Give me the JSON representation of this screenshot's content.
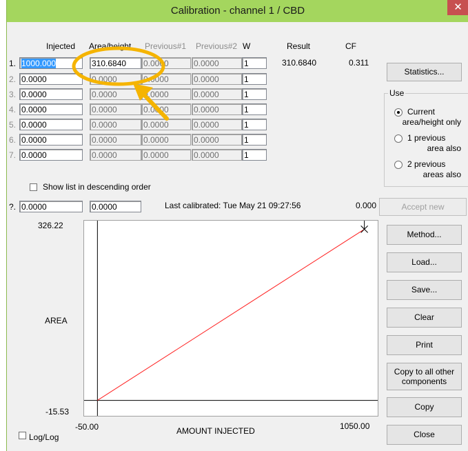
{
  "window": {
    "title": "Calibration - channel 1 / CBD",
    "close_glyph": "✕"
  },
  "table": {
    "headers": {
      "injected": "Injected",
      "area_height": "Area/height",
      "prev1": "Previous#1",
      "prev2": "Previous#2",
      "w": "W",
      "result": "Result",
      "cf": "CF"
    },
    "rows": [
      {
        "num": "1.",
        "injected": "1000.000",
        "area": "310.6840",
        "prev1": "0.0000",
        "prev2": "0.0000",
        "w": "1",
        "result": "310.6840",
        "cf": "0.311"
      },
      {
        "num": "2.",
        "injected": "0.0000",
        "area": "0.0000",
        "prev1": "0.0000",
        "prev2": "0.0000",
        "w": "1"
      },
      {
        "num": "3.",
        "injected": "0.0000",
        "area": "0.0000",
        "prev1": "0.0000",
        "prev2": "0.0000",
        "w": "1"
      },
      {
        "num": "4.",
        "injected": "0.0000",
        "area": "0.0000",
        "prev1": "0.0000",
        "prev2": "0.0000",
        "w": "1"
      },
      {
        "num": "5.",
        "injected": "0.0000",
        "area": "0.0000",
        "prev1": "0.0000",
        "prev2": "0.0000",
        "w": "1"
      },
      {
        "num": "6.",
        "injected": "0.0000",
        "area": "0.0000",
        "prev1": "0.0000",
        "prev2": "0.0000",
        "w": "1"
      },
      {
        "num": "7.",
        "injected": "0.0000",
        "area": "0.0000",
        "prev1": "0.0000",
        "prev2": "0.0000",
        "w": "1"
      }
    ],
    "descending_label": "Show list in descending order"
  },
  "query": {
    "num": "?.",
    "injected": "0.0000",
    "area": "0.0000",
    "last_calibrated": "Last calibrated:  Tue May 21 09:27:56",
    "value": "0.000"
  },
  "use_group": {
    "title": "Use",
    "options": [
      {
        "label1": "Current",
        "label2": "area/height only",
        "selected": true
      },
      {
        "label1": "1 previous",
        "label2": "area also",
        "selected": false
      },
      {
        "label1": "2 previous",
        "label2": "areas also",
        "selected": false
      }
    ]
  },
  "buttons": {
    "statistics": "Statistics...",
    "accept_new": "Accept new",
    "method": "Method...",
    "load": "Load...",
    "save": "Save...",
    "clear": "Clear",
    "print": "Print",
    "copy_all_1": "Copy to all other",
    "copy_all_2": "components",
    "copy": "Copy",
    "close": "Close"
  },
  "loglog_label": "Log/Log",
  "chart_data": {
    "type": "line",
    "xlabel": "AMOUNT INJECTED",
    "ylabel": "AREA",
    "xlim": [
      -50.0,
      1050.0
    ],
    "ylim": [
      -15.53,
      326.22
    ],
    "x_tick_labels": [
      "-50.00",
      "1050.00"
    ],
    "y_tick_labels": [
      "326.22",
      "-15.53"
    ],
    "series": [
      {
        "x": [
          0,
          1000
        ],
        "y": [
          0,
          310.684
        ],
        "color": "#ff2020"
      }
    ],
    "points": [
      {
        "x": 1000,
        "y": 310.684,
        "marker": "x"
      }
    ],
    "grid": false
  },
  "annotation": {
    "color": "#f5b400",
    "shape": "circle-with-arrow"
  }
}
